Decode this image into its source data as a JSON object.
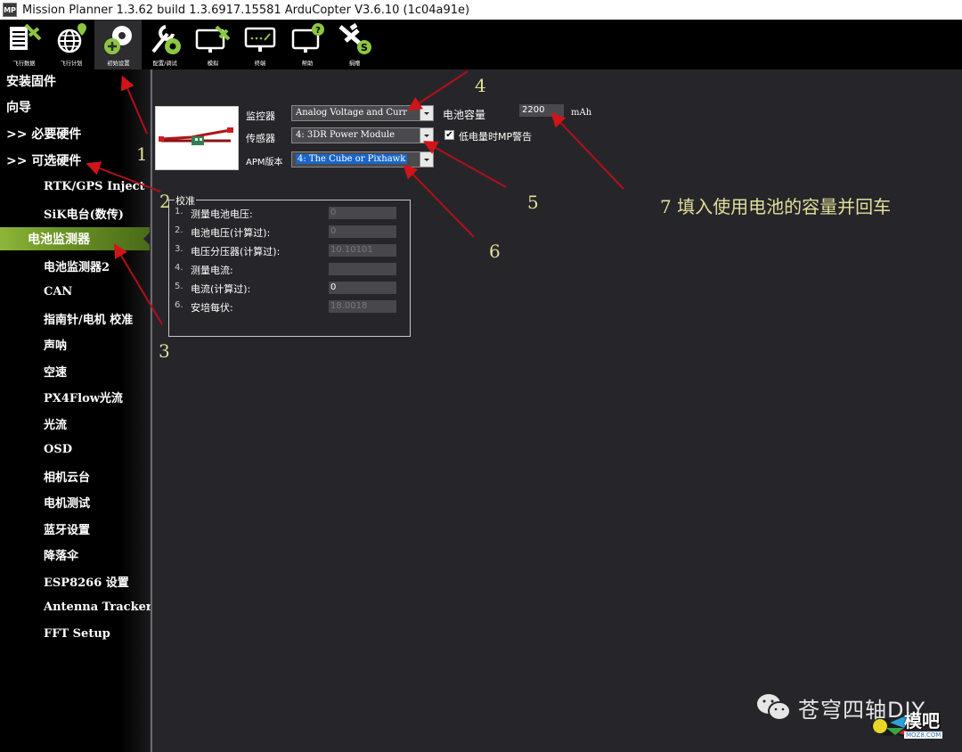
{
  "window": {
    "app_icon": "MP",
    "title": "Mission Planner 1.3.62 build 1.3.6917.15581 ArduCopter V3.6.10 (1c04a91e)"
  },
  "toolbar": {
    "buttons": [
      {
        "label": "飞行数据",
        "icon": "flight-data-icon"
      },
      {
        "label": "飞行计划",
        "icon": "flight-plan-icon"
      },
      {
        "label": "初始设置",
        "icon": "initial-setup-icon",
        "active": true
      },
      {
        "label": "配置/调试",
        "icon": "config-tuning-icon"
      },
      {
        "label": "模拟",
        "icon": "simulation-icon"
      },
      {
        "label": "终端",
        "icon": "terminal-icon"
      },
      {
        "label": "帮助",
        "icon": "help-icon"
      },
      {
        "label": "捐赠",
        "icon": "donate-icon"
      }
    ]
  },
  "sidebar": {
    "items": [
      {
        "label": "安装固件",
        "level": 0
      },
      {
        "label": "向导",
        "level": 0
      },
      {
        "label": ">> 必要硬件",
        "level": 0
      },
      {
        "label": ">> 可选硬件",
        "level": 0
      },
      {
        "label": "RTK/GPS Inject",
        "level": 1
      },
      {
        "label": "SiK电台(数传)",
        "level": 1
      },
      {
        "label": "电池监测器",
        "level": 1,
        "active": true
      },
      {
        "label": "电池监测器2",
        "level": 1
      },
      {
        "label": "CAN",
        "level": 1
      },
      {
        "label": "指南针/电机 校准",
        "level": 1
      },
      {
        "label": "声呐",
        "level": 1
      },
      {
        "label": "空速",
        "level": 1
      },
      {
        "label": "PX4Flow光流",
        "level": 1
      },
      {
        "label": "光流",
        "level": 1
      },
      {
        "label": "OSD",
        "level": 1
      },
      {
        "label": "相机云台",
        "level": 1
      },
      {
        "label": "电机测试",
        "level": 1
      },
      {
        "label": "蓝牙设置",
        "level": 1
      },
      {
        "label": "降落伞",
        "level": 1
      },
      {
        "label": "ESP8266 设置",
        "level": 1
      },
      {
        "label": "Antenna Tracker",
        "level": 1
      },
      {
        "label": "FFT Setup",
        "level": 1
      }
    ]
  },
  "battery_monitor": {
    "monitor_label": "监控器",
    "monitor_value": "Analog Voltage and Curr",
    "sensor_label": "传感器",
    "sensor_value": "4: 3DR Power Module",
    "apm_label": "APM版本",
    "apm_value": "4: The Cube or Pixhawk",
    "capacity_label": "电池容量",
    "capacity_value": "2200",
    "capacity_unit": "mAh",
    "mp_alert_label": "低电量时MP警告",
    "mp_alert_checked": true
  },
  "calibration": {
    "title": "校准",
    "rows": [
      {
        "num": "1.",
        "label": "测量电池电压:",
        "value": "0",
        "editable": false
      },
      {
        "num": "2.",
        "label": "电池电压(计算过):",
        "value": "0",
        "editable": false
      },
      {
        "num": "3.",
        "label": "电压分压器(计算过):",
        "value": "10.10101",
        "editable": false
      },
      {
        "num": "4.",
        "label": "测量电流:",
        "value": "",
        "editable": false
      },
      {
        "num": "5.",
        "label": "电流(计算过):",
        "value": "0",
        "editable": true
      },
      {
        "num": "6.",
        "label": "安培每伏:",
        "value": "18.0018",
        "editable": false
      }
    ]
  },
  "annotations": {
    "a1": "1",
    "a2": "2",
    "a3": "3",
    "a4": "4",
    "a5": "5",
    "a6": "6",
    "a7": "7  填入使用电池的容量并回车",
    "arrow_color": "#c0141a",
    "text_color": "#e3df9a"
  },
  "watermark": {
    "text": "苍穹四轴DIY",
    "logo_text": "模吧",
    "logo_url": "MOZ8.COM"
  }
}
